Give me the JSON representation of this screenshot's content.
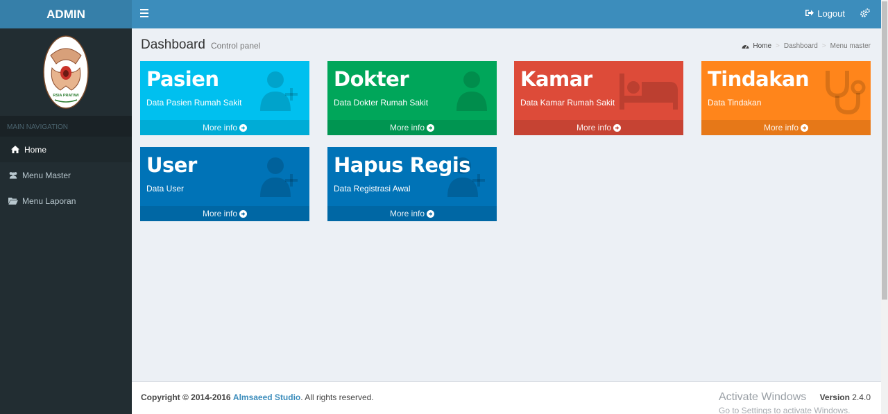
{
  "brand": "ADMIN",
  "logo_text": "RSIA PRATIWI",
  "sidebar": {
    "header": "MAIN NAVIGATION",
    "items": [
      {
        "label": "Home",
        "icon": "home-icon"
      },
      {
        "label": "Menu Master",
        "icon": "users-icon"
      },
      {
        "label": "Menu Laporan",
        "icon": "folder-open-icon"
      }
    ]
  },
  "topbar": {
    "logout_label": "Logout"
  },
  "page": {
    "title": "Dashboard",
    "subtitle": "Control panel",
    "breadcrumb": [
      "Home",
      "Dashboard",
      "Menu master"
    ]
  },
  "boxes": [
    {
      "title": "Pasien",
      "subtitle": "Data Pasien Rumah Sakit",
      "link": "More info",
      "color": "#00c0ef",
      "icon": "user-plus-icon"
    },
    {
      "title": "Dokter",
      "subtitle": "Data Dokter Rumah Sakit",
      "link": "More info",
      "color": "#00a65a",
      "icon": "user-icon"
    },
    {
      "title": "Kamar",
      "subtitle": "Data Kamar Rumah Sakit",
      "link": "More info",
      "color": "#dd4b39",
      "icon": "bed-icon"
    },
    {
      "title": "Tindakan",
      "subtitle": "Data Tindakan",
      "link": "More info",
      "color": "#ff851b",
      "icon": "stethoscope-icon"
    },
    {
      "title": "User",
      "subtitle": "Data User",
      "link": "More info",
      "color": "#0073b7",
      "icon": "user-plus-icon"
    },
    {
      "title": "Hapus Regis",
      "subtitle": "Data Registrasi Awal",
      "link": "More info",
      "color": "#0073b7",
      "icon": "user-plus-icon"
    }
  ],
  "footer": {
    "copyright_prefix": "Copyright © 2014-2016",
    "studio": "Almsaeed Studio",
    "suffix": ". All rights reserved.",
    "version_label": "Version",
    "version": "2.4.0"
  },
  "watermark": {
    "line1": "Activate Windows",
    "line2": "Go to Settings to activate Windows."
  }
}
